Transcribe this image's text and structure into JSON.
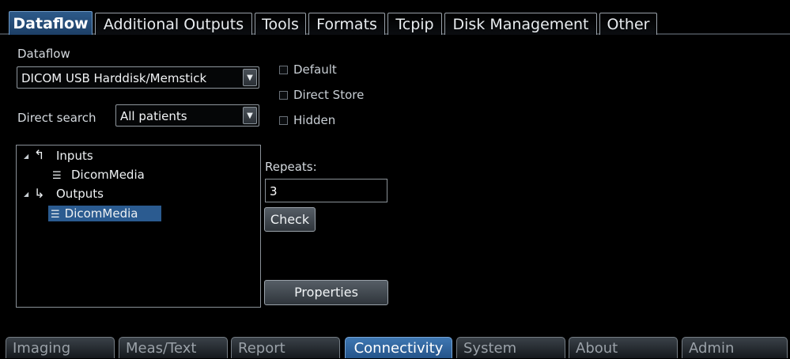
{
  "top_tabs": [
    {
      "label": "Dataflow",
      "active": true
    },
    {
      "label": "Additional Outputs",
      "active": false
    },
    {
      "label": "Tools",
      "active": false
    },
    {
      "label": "Formats",
      "active": false
    },
    {
      "label": "Tcpip",
      "active": false
    },
    {
      "label": "Disk Management",
      "active": false
    },
    {
      "label": "Other",
      "active": false
    }
  ],
  "dataflow": {
    "label": "Dataflow",
    "selected": "DICOM USB Harddisk/Memstick"
  },
  "direct_search": {
    "label": "Direct search",
    "selected": "All patients"
  },
  "options": [
    {
      "label": "Default",
      "checked": false
    },
    {
      "label": "Direct Store",
      "checked": false
    },
    {
      "label": "Hidden",
      "checked": false
    }
  ],
  "tree": {
    "inputs_label": "Inputs",
    "inputs_child": "DicomMedia",
    "outputs_label": "Outputs",
    "outputs_child": "DicomMedia"
  },
  "repeats": {
    "label": "Repeats:",
    "value": "3"
  },
  "buttons": {
    "check": "Check",
    "properties": "Properties"
  },
  "bottom_tabs": [
    {
      "label": "Imaging",
      "active": false
    },
    {
      "label": "Meas/Text",
      "active": false
    },
    {
      "label": "Report",
      "active": false
    },
    {
      "label": "Connectivity",
      "active": true
    },
    {
      "label": "System",
      "active": false
    },
    {
      "label": "About",
      "active": false
    },
    {
      "label": "Admin",
      "active": false
    }
  ],
  "colors": {
    "active_tab": "#2d5a8a",
    "selection": "#2b5b90"
  }
}
